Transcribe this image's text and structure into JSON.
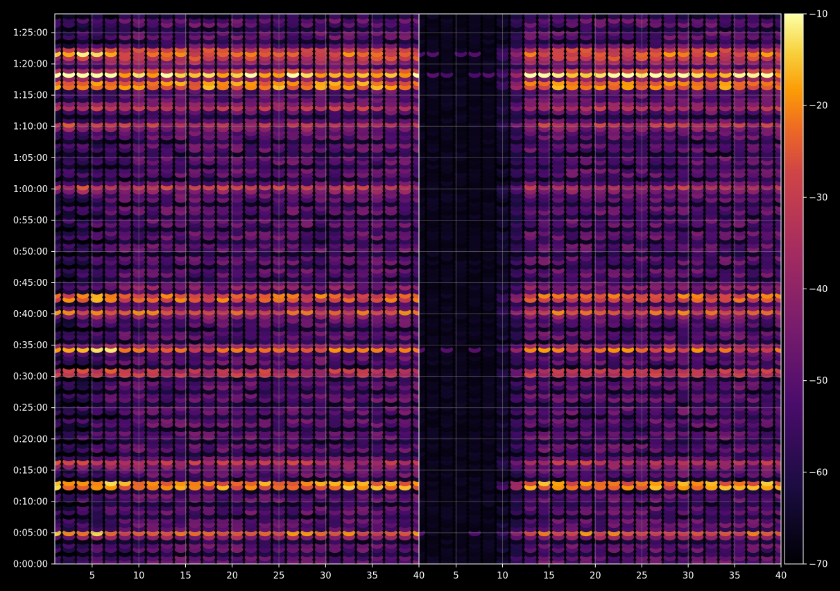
{
  "chart_data": [
    {
      "type": "heatmap",
      "title": "",
      "xlabel": "",
      "ylabel": "",
      "x_ticks": [
        "5",
        "10",
        "15",
        "20",
        "25",
        "30",
        "35",
        "40"
      ],
      "xlim": [
        1,
        40
      ],
      "y_ticks": [
        "0:00:00",
        "0:05:00",
        "0:10:00",
        "0:15:00",
        "0:20:00",
        "0:25:00",
        "0:30:00",
        "0:35:00",
        "0:40:00",
        "0:45:00",
        "0:50:00",
        "0:55:00",
        "1:00:00",
        "1:05:00",
        "1:10:00",
        "1:15:00",
        "1:20:00",
        "1:25:00"
      ],
      "ylim": [
        "0:00:00",
        "1:28:00"
      ],
      "grid": true,
      "bright_rows": [
        "0:05:00",
        "0:12:40",
        "0:16:00",
        "0:30:40",
        "0:34:20",
        "0:40:00",
        "0:42:40",
        "1:00:00",
        "1:10:00",
        "1:13:20",
        "1:16:40",
        "1:18:20",
        "1:21:40"
      ]
    },
    {
      "type": "heatmap",
      "title": "",
      "xlabel": "",
      "ylabel": "",
      "x_ticks": [
        "5",
        "10",
        "15",
        "20",
        "25",
        "30",
        "35",
        "40"
      ],
      "xlim": [
        1,
        40
      ],
      "ylim": [
        "0:00:00",
        "1:28:00"
      ],
      "grid": true,
      "low_region_x": [
        1,
        10
      ]
    }
  ],
  "colorbar": {
    "colormap": "inferno",
    "range": [
      -70,
      -10
    ],
    "ticks": [
      "−10",
      "−20",
      "−30",
      "−40",
      "−50",
      "−60",
      "−70"
    ]
  },
  "colors": {
    "background": "#000000",
    "text": "#ffffff",
    "grid": "#8a8a8a"
  }
}
